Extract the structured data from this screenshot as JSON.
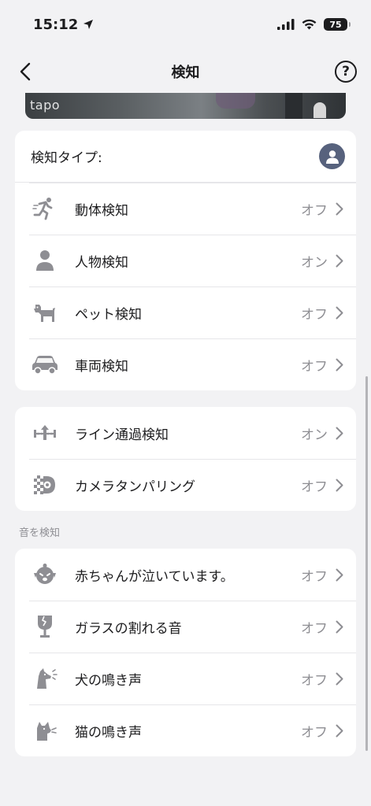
{
  "status_bar": {
    "time": "15:12",
    "battery": "75"
  },
  "nav": {
    "title": "検知"
  },
  "preview": {
    "logo": "tapo"
  },
  "detection_card": {
    "header_label": "検知タイプ:",
    "items": [
      {
        "label": "動体検知",
        "value": "オフ",
        "icon": "running-person-icon"
      },
      {
        "label": "人物検知",
        "value": "オン",
        "icon": "person-icon"
      },
      {
        "label": "ペット検知",
        "value": "オフ",
        "icon": "dog-icon"
      },
      {
        "label": "車両検知",
        "value": "オフ",
        "icon": "car-icon"
      }
    ]
  },
  "advanced_card": {
    "items": [
      {
        "label": "ライン通過検知",
        "value": "オン",
        "icon": "line-crossing-icon"
      },
      {
        "label": "カメラタンパリング",
        "value": "オフ",
        "icon": "camera-tampering-icon"
      }
    ]
  },
  "sound_section": {
    "title": "音を検知",
    "items": [
      {
        "label": "赤ちゃんが泣いています。",
        "value": "オフ",
        "icon": "crying-baby-icon"
      },
      {
        "label": "ガラスの割れる音",
        "value": "オフ",
        "icon": "broken-glass-icon"
      },
      {
        "label": "犬の鳴き声",
        "value": "オフ",
        "icon": "dog-bark-icon"
      },
      {
        "label": "猫の鳴き声",
        "value": "オフ",
        "icon": "cat-meow-icon"
      }
    ]
  },
  "colors": {
    "icon_gray": "#8e8e93",
    "avatar": "#57627d",
    "background": "#f2f2f4"
  }
}
